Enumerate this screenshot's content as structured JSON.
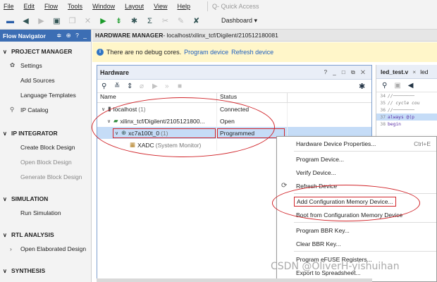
{
  "menubar": {
    "items": [
      "File",
      "Edit",
      "Flow",
      "Tools",
      "Window",
      "Layout",
      "View",
      "Help"
    ],
    "quick_access_placeholder": "Q- Quick Access"
  },
  "toolbar": {
    "dashboard_label": "Dashboard"
  },
  "nav": {
    "title": "Flow Navigator",
    "controls": "≑ ⊕ ? _",
    "sections": [
      {
        "label": "PROJECT MANAGER",
        "items": [
          "Settings",
          "Add Sources",
          "Language Templates",
          "IP Catalog"
        ]
      },
      {
        "label": "IP INTEGRATOR",
        "items": [
          "Create Block Design",
          "Open Block Design",
          "Generate Block Design"
        ]
      },
      {
        "label": "SIMULATION",
        "items": [
          "Run Simulation"
        ]
      },
      {
        "label": "RTL ANALYSIS",
        "items": [
          "Open Elaborated Design"
        ]
      },
      {
        "label": "SYNTHESIS",
        "items": []
      }
    ]
  },
  "main": {
    "header_label": "HARDWARE MANAGER",
    "header_path": " - localhost/xilinx_tcf/Digilent/210512180081"
  },
  "info_bar": {
    "message": "There are no debug cores.",
    "link1": "Program device",
    "link2": "Refresh device"
  },
  "hardware": {
    "title": "Hardware",
    "controls": "? _ □ ⧉ ✕",
    "columns": [
      "Name",
      "Status"
    ],
    "rows": [
      {
        "name": "localhost",
        "count": "(1)",
        "status": "Connected"
      },
      {
        "name": "xilinx_tcf/Digilent/2105121800...",
        "count": "",
        "status": "Open"
      },
      {
        "name": "xc7a100t_0",
        "count": "(1)",
        "status": "Programmed"
      },
      {
        "name": "XADC",
        "count": "(System Monitor)",
        "status": ""
      }
    ]
  },
  "editor": {
    "tab_active": "led_test.v",
    "tab_next": "led",
    "lines": [
      {
        "n": "34",
        "text": "//────────",
        "type": "cm"
      },
      {
        "n": "35",
        "text": "// cycle cou",
        "type": "cm"
      },
      {
        "n": "36",
        "text": "//────────",
        "type": "cm"
      },
      {
        "n": "37",
        "text": "always @(p",
        "type": "kw"
      },
      {
        "n": "38",
        "text": "    begin",
        "type": "kw"
      }
    ]
  },
  "context_menu": {
    "groups": [
      [
        {
          "label": "Hardware Device Properties...",
          "shortcut": "Ctrl+E"
        }
      ],
      [
        {
          "label": "Program Device..."
        },
        {
          "label": "Verify Device..."
        },
        {
          "label": "Refresh Device",
          "icon": "refresh"
        }
      ],
      [
        {
          "label": "Add Configuration Memory Device..."
        },
        {
          "label": "Boot from Configuration Memory Device"
        }
      ],
      [
        {
          "label": "Program BBR Key..."
        },
        {
          "label": "Clear BBR Key..."
        }
      ],
      [
        {
          "label": "Program eFUSE Registers..."
        },
        {
          "label": "Export to Spreadsheet..."
        }
      ]
    ]
  },
  "watermark": "CSDN @OliverH-yishuihan",
  "colors": {
    "nav_header": "#3c6eb4",
    "selection": "#c5dcf7",
    "annotation_red": "#d1252a",
    "info_bg": "#fff6c9",
    "link": "#1f5fbf"
  }
}
